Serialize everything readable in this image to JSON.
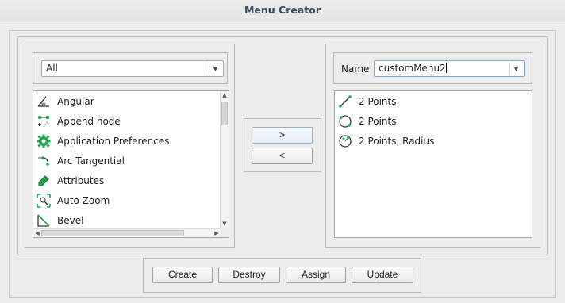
{
  "window": {
    "title": "Menu Creator"
  },
  "left": {
    "filter_value": "All",
    "items": [
      {
        "label": "Angular",
        "icon": "angular-icon"
      },
      {
        "label": "Append node",
        "icon": "append-node-icon"
      },
      {
        "label": "Application Preferences",
        "icon": "gear-icon"
      },
      {
        "label": "Arc Tangential",
        "icon": "arc-tangential-icon"
      },
      {
        "label": "Attributes",
        "icon": "attributes-icon"
      },
      {
        "label": "Auto Zoom",
        "icon": "auto-zoom-icon"
      },
      {
        "label": "Bevel",
        "icon": "bevel-icon"
      }
    ]
  },
  "transfer": {
    "add_label": ">",
    "remove_label": "<"
  },
  "right": {
    "name_label": "Name",
    "menu_name": "customMenu2",
    "items": [
      {
        "label": "2 Points",
        "icon": "line-2-points-icon"
      },
      {
        "label": "2 Points",
        "icon": "circle-2-points-icon"
      },
      {
        "label": "2 Points, Radius",
        "icon": "circle-2-points-radius-icon"
      }
    ]
  },
  "actions": {
    "create": "Create",
    "destroy": "Destroy",
    "assign": "Assign",
    "update": "Update"
  },
  "colors": {
    "icon_green": "#1ea74f",
    "title_text": "#3b4b5a",
    "focus": "#7ea6d6"
  }
}
